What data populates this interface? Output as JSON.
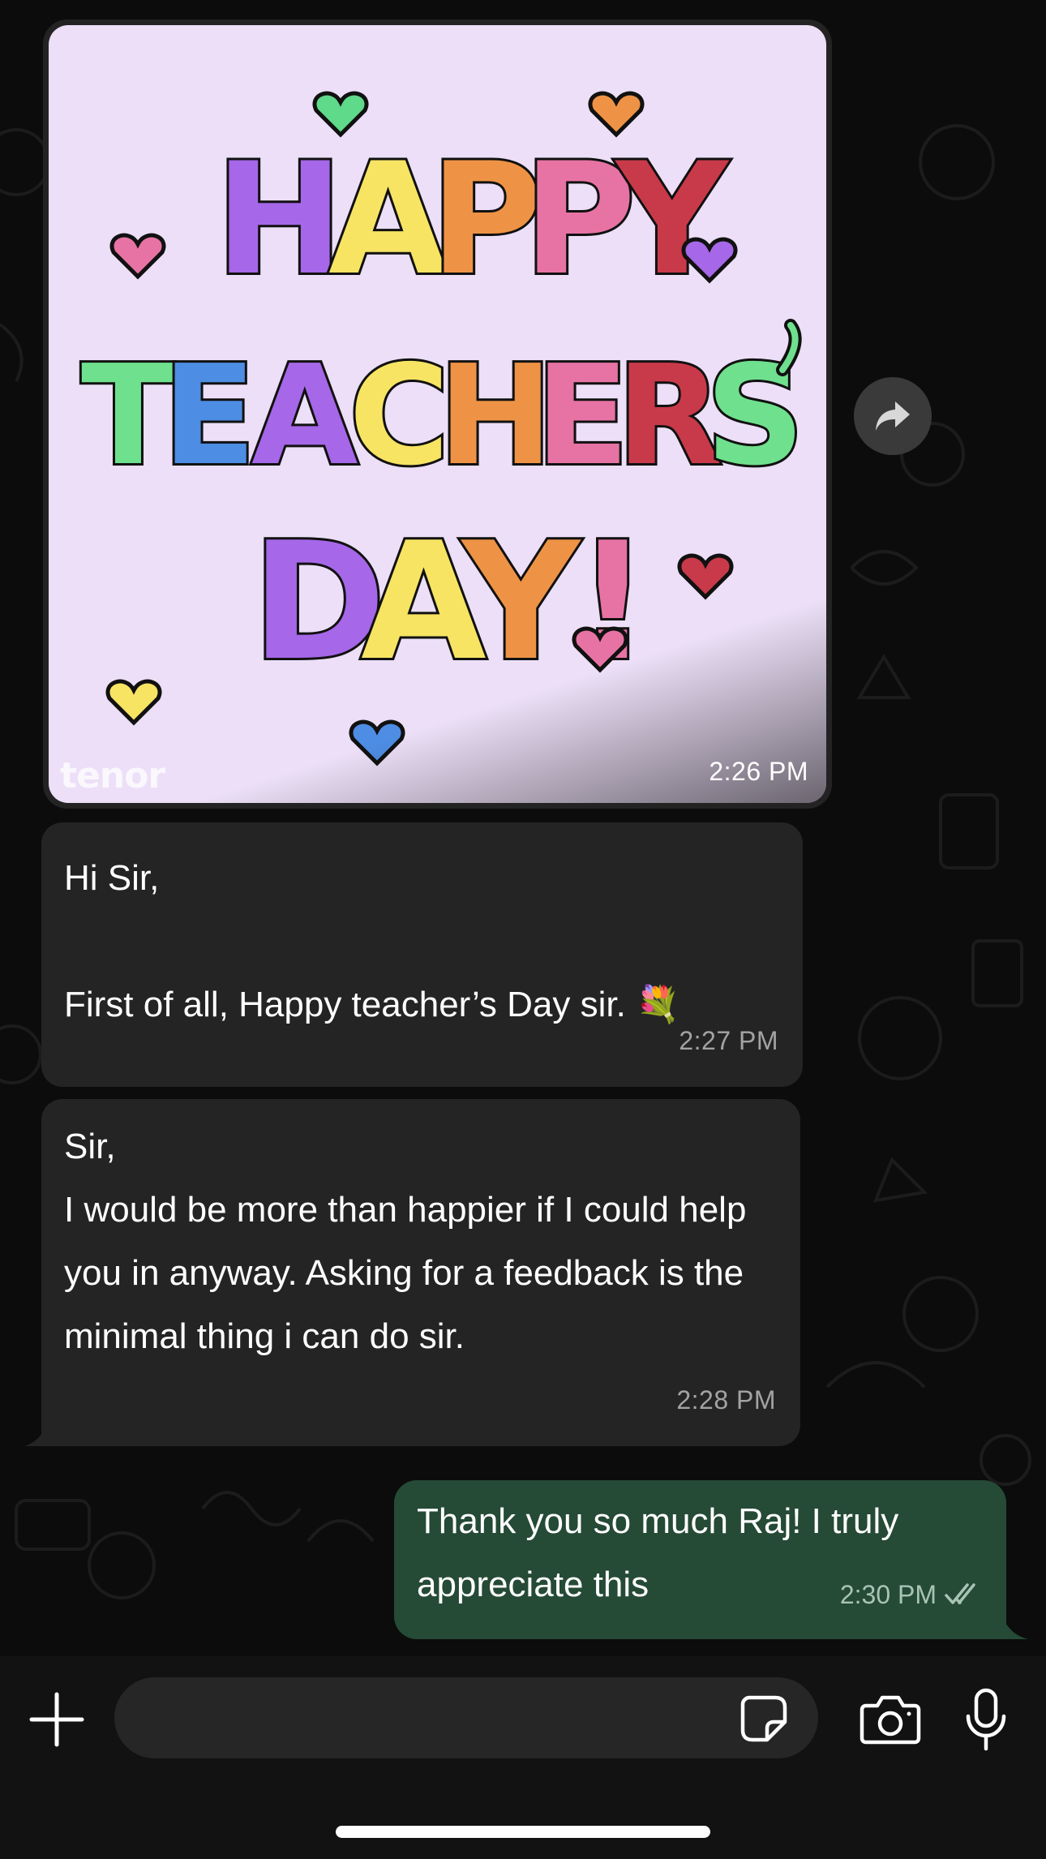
{
  "gif_message": {
    "image_text_line1": "HAPPY",
    "image_text_line2": "TEACHERS'",
    "image_text_line3": "DAY!",
    "watermark": "tenor",
    "time": "2:26 PM"
  },
  "messages": [
    {
      "direction": "incoming",
      "text": "Hi Sir,\n\nFirst of all, Happy teacher’s Day sir. 💐",
      "time": "2:27 PM"
    },
    {
      "direction": "incoming",
      "text": "Sir,\nI would be more than happier if I could help you in anyway. Asking for a feedback is the minimal thing i can do sir.",
      "time": "2:28 PM"
    },
    {
      "direction": "outgoing",
      "text": "Thank you so much Raj! I truly appreciate this",
      "time": "2:30 PM",
      "status": "read"
    }
  ],
  "icons": {
    "forward": "forward-icon",
    "plus": "plus-icon",
    "sticker": "sticker-icon",
    "camera": "camera-icon",
    "mic": "microphone-icon",
    "read_receipt": "double-check-icon"
  },
  "colors": {
    "incoming_bubble": "#242424",
    "outgoing_bubble": "#254a36",
    "background": "#0b0b0b",
    "gif_background": "#ecdff7"
  },
  "input": {
    "value": "",
    "placeholder": ""
  }
}
